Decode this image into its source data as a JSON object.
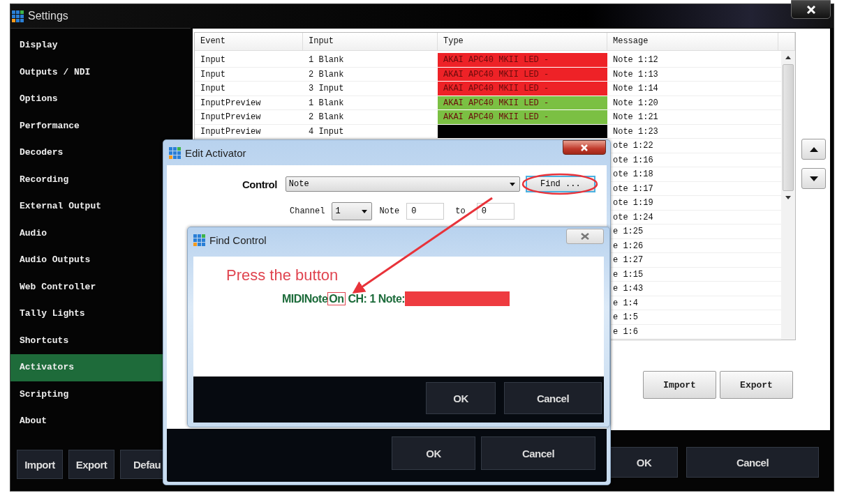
{
  "settings": {
    "title": "Settings",
    "sidebar": {
      "items": [
        {
          "label": "Display",
          "selected": false
        },
        {
          "label": "Outputs / NDI",
          "selected": false
        },
        {
          "label": "Options",
          "selected": false
        },
        {
          "label": "Performance",
          "selected": false
        },
        {
          "label": "Decoders",
          "selected": false
        },
        {
          "label": "Recording",
          "selected": false
        },
        {
          "label": "External Output",
          "selected": false
        },
        {
          "label": "Audio",
          "selected": false
        },
        {
          "label": "Audio Outputs",
          "selected": false
        },
        {
          "label": "Web Controller",
          "selected": false
        },
        {
          "label": "Tally Lights",
          "selected": false
        },
        {
          "label": "Shortcuts",
          "selected": false
        },
        {
          "label": "Activators",
          "selected": true
        },
        {
          "label": "Scripting",
          "selected": false
        },
        {
          "label": "About",
          "selected": false
        }
      ],
      "buttons": [
        "Import",
        "Export",
        "Defau"
      ]
    },
    "table": {
      "columns": [
        "Event",
        "Input",
        "Type",
        "Message"
      ],
      "rows": [
        {
          "event": "Input",
          "input": "1 Blank",
          "type": {
            "text": "AKAI APC40 MKII LED -",
            "color": "#ee2227"
          },
          "message": "Note 1:12"
        },
        {
          "event": "Input",
          "input": "2 Blank",
          "type": {
            "text": "AKAI APC40 MKII LED -",
            "color": "#ee2227"
          },
          "message": "Note 1:13"
        },
        {
          "event": "Input",
          "input": "3 Input",
          "type": {
            "text": "AKAI APC40 MKII LED -",
            "color": "#ee2227"
          },
          "message": "Note 1:14"
        },
        {
          "event": "InputPreview",
          "input": "1 Blank",
          "type": {
            "text": "AKAI APC40 MKII LED -",
            "color": "#7bc043"
          },
          "message": "Note 1:20"
        },
        {
          "event": "InputPreview",
          "input": "2 Blank",
          "type": {
            "text": "AKAI APC40 MKII LED -",
            "color": "#7bc043"
          },
          "message": "Note 1:21"
        },
        {
          "event": "InputPreview",
          "input": "4 Input",
          "type": {
            "color": "#000000"
          },
          "message": "Note 1:23"
        },
        {
          "message": "ote 1:22"
        },
        {
          "message": "ote 1:16"
        },
        {
          "message": "ote 1:18"
        },
        {
          "message": "ote 1:17"
        },
        {
          "message": "ote 1:19"
        },
        {
          "message": "ote 1:24"
        },
        {
          "message": "e 1:25"
        },
        {
          "message": "e 1:26"
        },
        {
          "message": "e 1:27"
        },
        {
          "message": "e 1:15"
        },
        {
          "message": "e 1:43"
        },
        {
          "message": "e 1:4"
        },
        {
          "message": "e 1:5"
        },
        {
          "message": "e 1:6"
        }
      ]
    },
    "panel_buttons": [
      "Import",
      "Export"
    ],
    "footer_buttons": [
      "OK",
      "Cancel"
    ]
  },
  "edit_activator": {
    "title": "Edit Activator",
    "control_label": "Control",
    "control_value": "Note",
    "find_button": "Find ...",
    "channel_label": "Channel",
    "channel_value": "1",
    "note_label": "Note",
    "note_from": "0",
    "to_label": "to",
    "note_to": "0",
    "footer_buttons": [
      "OK",
      "Cancel"
    ]
  },
  "find_control": {
    "title": "Find Control",
    "annotation": "Press the button",
    "message": {
      "prefix": "MIDINote",
      "highlight": "On",
      "suffix": " CH: 1 Note:"
    },
    "footer_buttons": [
      "OK",
      "Cancel"
    ]
  }
}
